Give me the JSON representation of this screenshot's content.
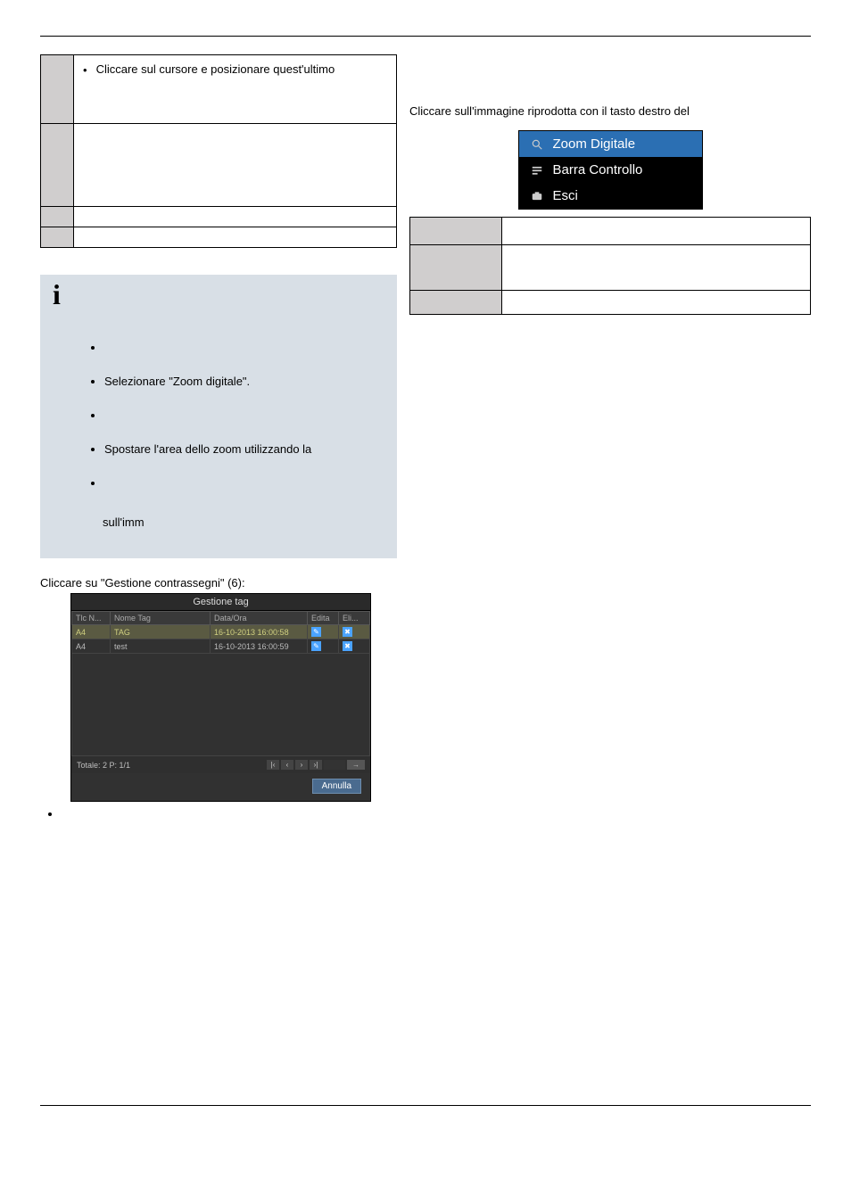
{
  "left_table": {
    "row1_text": "Cliccare sul cursore e posizionare quest'ultimo"
  },
  "right_col": {
    "intro": "Cliccare sull'immagine riprodotta con il tasto destro del"
  },
  "context_menu": {
    "items": [
      {
        "icon": "magnifier",
        "label": "Zoom Digitale"
      },
      {
        "icon": "bars",
        "label": "Barra Controllo"
      },
      {
        "icon": "camera",
        "label": "Esci"
      }
    ]
  },
  "info_block": {
    "bullets": [
      "",
      "Selezionare \"Zoom digitale\".",
      "",
      "Spostare l'area dello zoom utilizzando la",
      ""
    ],
    "trailing_text": "sull'imm"
  },
  "section_text": "Cliccare su \"Gestione contrassegni\" (6):",
  "tag_window": {
    "title": "Gestione tag",
    "headers": [
      "Tlc N...",
      "Nome Tag",
      "Data/Ora",
      "Edita",
      "Eli..."
    ],
    "rows": [
      {
        "cam": "A4",
        "name": "TAG",
        "dt": "16-10-2013 16:00:58"
      },
      {
        "cam": "A4",
        "name": "test",
        "dt": "16-10-2013 16:00:59"
      }
    ],
    "footer_total": "Totale: 2 P: 1/1",
    "pager_go": "→",
    "cancel_label": "Annulla"
  }
}
